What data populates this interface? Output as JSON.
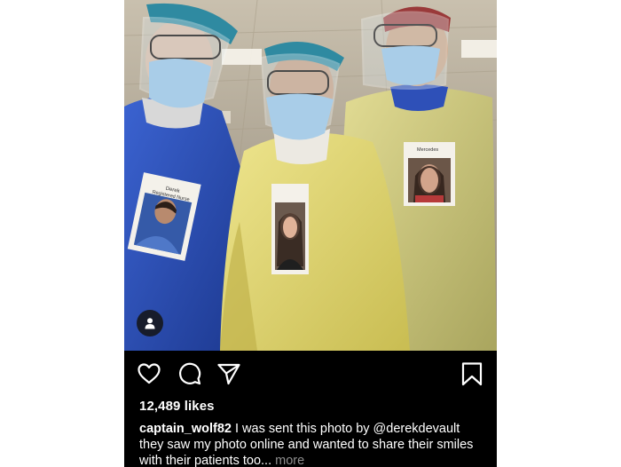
{
  "post": {
    "photo": {
      "badges": [
        {
          "name": "Derek",
          "role": "Registered Nurse"
        },
        {
          "name": "",
          "role": ""
        },
        {
          "name": "Mercedes",
          "role": ""
        }
      ]
    },
    "likes": "12,489 likes",
    "caption": {
      "username": "captain_wolf82",
      "text_before": " I was sent this photo by ",
      "mention": "@derekdevault",
      "text_after": " they saw my photo online and wanted to share their smiles with their patients too...",
      "more": " more"
    },
    "icons": {
      "like": "heart-icon",
      "comment": "comment-icon",
      "share": "paper-plane-icon",
      "save": "bookmark-icon",
      "tagged": "person-icon"
    },
    "colors": {
      "background": "#000000",
      "text": "#ffffff",
      "muted": "#8e8e8e",
      "gown_yellow": "#e3d878",
      "scrubs_blue": "#2e50b8",
      "mask_blue": "#a9cde8"
    }
  }
}
